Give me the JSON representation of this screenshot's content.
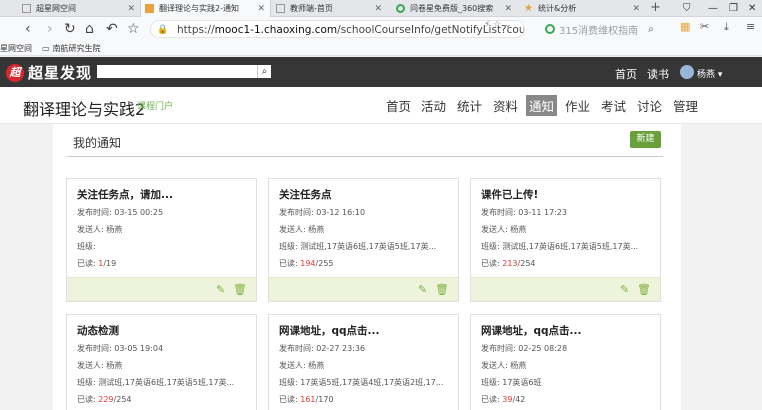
{
  "browser": {
    "tabs": [
      {
        "title": "超星网空间",
        "active": false
      },
      {
        "title": "翻译理论与实践2-通知",
        "active": true
      },
      {
        "title": "教师端-首页",
        "active": false
      },
      {
        "title": "问卷星免费版_360搜索",
        "active": false
      },
      {
        "title": "统计&分析",
        "active": false
      }
    ],
    "new_tab": "+",
    "url_prefix": "https://",
    "url_host": "mooc1-1.chaoxing.com",
    "url_path": "/schoolCourseInfo/getNotifyList?courseId=",
    "search_placeholder": "315消费维权指南",
    "bookmarks": [
      "星网空间",
      "南航研究生院"
    ]
  },
  "site": {
    "brand": "超星发现",
    "nav": [
      "首页",
      "读书"
    ],
    "user": "杨燕 ▾"
  },
  "course": {
    "title": "翻译理论与实践2",
    "subtitle": "课程门户",
    "nav": [
      "首页",
      "活动",
      "统计",
      "资料",
      "通知",
      "作业",
      "考试",
      "讨论",
      "管理"
    ],
    "active": "通知"
  },
  "panel": {
    "title": "我的通知",
    "new_button": "新建"
  },
  "labels": {
    "time": "发布时间: ",
    "sender": "发送人: ",
    "class": "班级: ",
    "read": "已读: "
  },
  "notices": [
    {
      "title": "关注任务点，请加...",
      "time": "03-15 00:25",
      "sender": "杨燕",
      "class": "",
      "read": "1",
      "total": "/19"
    },
    {
      "title": "关注任务点",
      "time": "03-12 16:10",
      "sender": "杨燕",
      "class": "测试班,17英语6班,17英语5班,17英...",
      "read": "194",
      "total": "/255"
    },
    {
      "title": "课件已上传!",
      "time": "03-11 17:23",
      "sender": "杨燕",
      "class": "测试班,17英语6班,17英语5班,17英...",
      "read": "213",
      "total": "/254"
    },
    {
      "title": "动态检测",
      "time": "03-05 19:04",
      "sender": "杨燕",
      "class": "测试班,17英语6班,17英语5班,17英...",
      "read": "229",
      "total": "/254"
    },
    {
      "title": "网课地址，qq点击...",
      "time": "02-27 23:36",
      "sender": "杨燕",
      "class": "17英语5班,17英语4班,17英语2班,17...",
      "read": "161",
      "total": "/170"
    },
    {
      "title": "网课地址，qq点击...",
      "time": "02-25 08:28",
      "sender": "杨燕",
      "class": "17英语6班",
      "read": "39",
      "total": "/42"
    }
  ],
  "colors": {
    "accent_green": "#69a03a",
    "read_red": "#e03a2f",
    "header_dark": "#363636"
  },
  "icons": [
    "edit-icon",
    "trash-icon"
  ]
}
